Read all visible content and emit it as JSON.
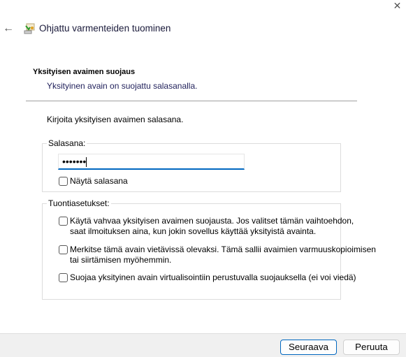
{
  "window": {
    "title": "Ohjattu varmenteiden tuominen",
    "close_icon": "close-icon",
    "back_icon": "back-arrow-icon",
    "app_icon": "certificate-import-icon"
  },
  "page": {
    "heading": "Yksityisen avaimen suojaus",
    "subtext": "Yksityinen avain on suojattu salasanalla.",
    "instruction": "Kirjoita yksityisen avaimen salasana."
  },
  "password_group": {
    "label": "Salasana:",
    "masked_value": "•••••••",
    "show_password_label": "Näytä salasana",
    "show_password_checked": false
  },
  "import_options": {
    "label": "Tuontiasetukset:",
    "options": [
      {
        "label_line1": "Käytä vahvaa yksityisen avaimen suojausta. Jos valitset tämän vaihtoehdon,",
        "label_line2": "saat ilmoituksen aina, kun jokin sovellus käyttää yksityistä avainta.",
        "checked": false
      },
      {
        "label_line1": "Merkitse tämä avain vietävissä olevaksi. Tämä sallii avaimien varmuuskopioimisen",
        "label_line2": "tai siirtämisen myöhemmin.",
        "checked": false
      },
      {
        "label_line1": "Suojaa yksityinen avain virtualisointiin perustuvalla suojauksella (ei voi viedä)",
        "checked": false
      }
    ]
  },
  "footer": {
    "next_label": "Seuraava",
    "cancel_label": "Peruuta"
  },
  "colors": {
    "accent": "#0067c0",
    "footer_bg": "#f0f0f0"
  }
}
